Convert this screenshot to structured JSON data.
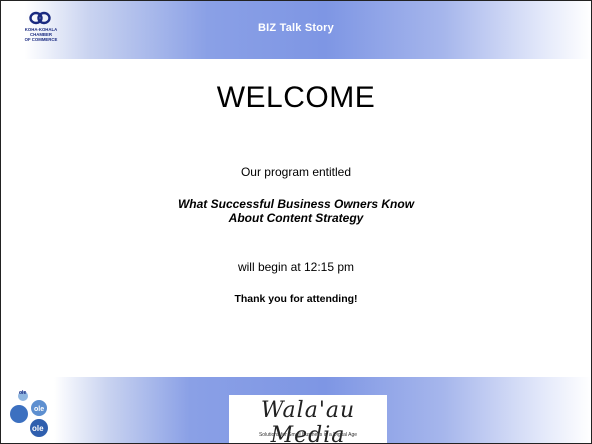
{
  "header": {
    "title": "BIZ Talk Story"
  },
  "chamber_logo": {
    "lines": [
      "KOHA-KOHALA",
      "CHAMBER",
      "OF COMMERCE"
    ]
  },
  "main": {
    "welcome": "WELCOME",
    "intro": "Our program entitled",
    "program_title_line1": "What Successful Business Owners Know",
    "program_title_line2": "About Content Strategy",
    "begin": "will begin at 12:15 pm",
    "thanks": "Thank you for attending!"
  },
  "footer": {
    "brand_name": "Wala'au Media",
    "tagline": "Solutions for Small Business in a Digital Age"
  },
  "colors": {
    "band": "#8aa0e6",
    "logo_blue": "#1a2a80"
  }
}
